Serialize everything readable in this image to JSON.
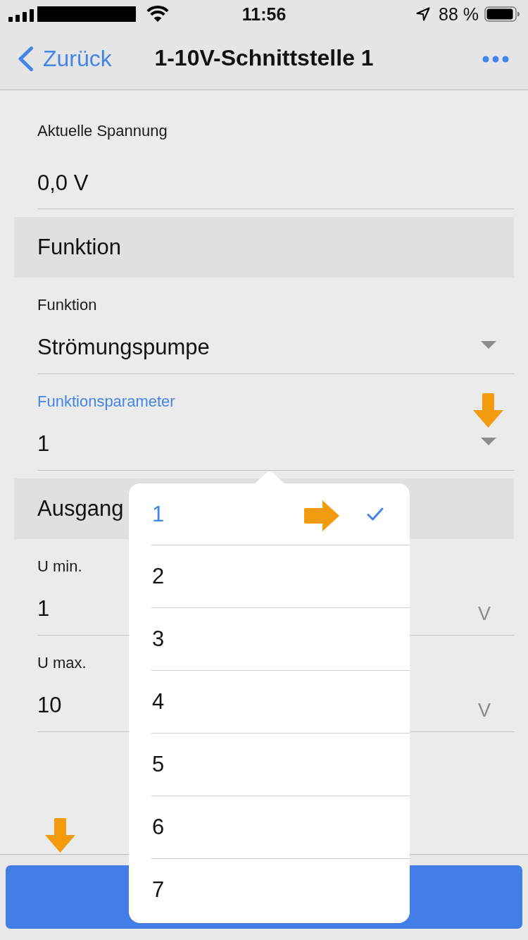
{
  "status_bar": {
    "time": "11:56",
    "battery": "88 %"
  },
  "nav_bar": {
    "back": "Zurück",
    "title": "1-10V-Schnittstelle 1"
  },
  "form": [
    {
      "kind": "reading",
      "label": "Aktuelle Spannung",
      "value": "0,0 V"
    },
    {
      "kind": "section",
      "title": "Funktion"
    },
    {
      "kind": "select",
      "label": "Funktion",
      "value": "Strömungspumpe",
      "focused": false
    },
    {
      "kind": "select",
      "label": "Funktionsparameter",
      "value": "1",
      "focused": true
    },
    {
      "kind": "section",
      "title": "Ausgang"
    },
    {
      "kind": "number",
      "label": "U min.",
      "value": "1",
      "unit": "V",
      "focused": false
    },
    {
      "kind": "number",
      "label": "U max.",
      "value": "10",
      "unit": "V",
      "focused": false
    }
  ],
  "popover": {
    "options": [
      {
        "label": "1",
        "selected": true
      },
      {
        "label": "2",
        "selected": false
      },
      {
        "label": "3",
        "selected": false
      },
      {
        "label": "4",
        "selected": false
      },
      {
        "label": "5",
        "selected": false
      },
      {
        "label": "6",
        "selected": false
      },
      {
        "label": "7",
        "selected": false
      }
    ]
  }
}
